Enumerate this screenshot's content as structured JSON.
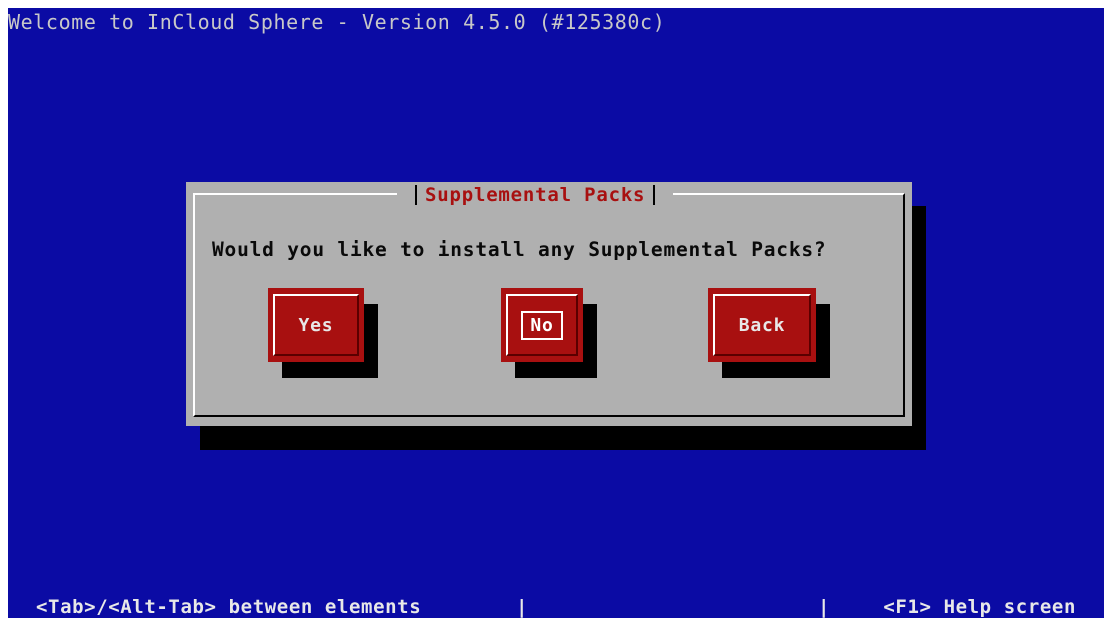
{
  "window": {
    "title": "Welcome to InCloud Sphere - Version 4.5.0 (#125380c)"
  },
  "dialog": {
    "title": "Supplemental Packs",
    "question": "Would you like to install any Supplemental Packs?",
    "buttons": {
      "yes": "Yes",
      "no": "No",
      "back": "Back"
    },
    "focused_button": "No"
  },
  "status_bar": {
    "left": "<Tab>/<Alt-Tab> between elements",
    "separator": "|",
    "right": "<F1> Help screen"
  },
  "colors": {
    "background": "#0b0ba4",
    "dialog": "#b0b0b0",
    "button": "#a81010",
    "title_text": "#a81010"
  }
}
